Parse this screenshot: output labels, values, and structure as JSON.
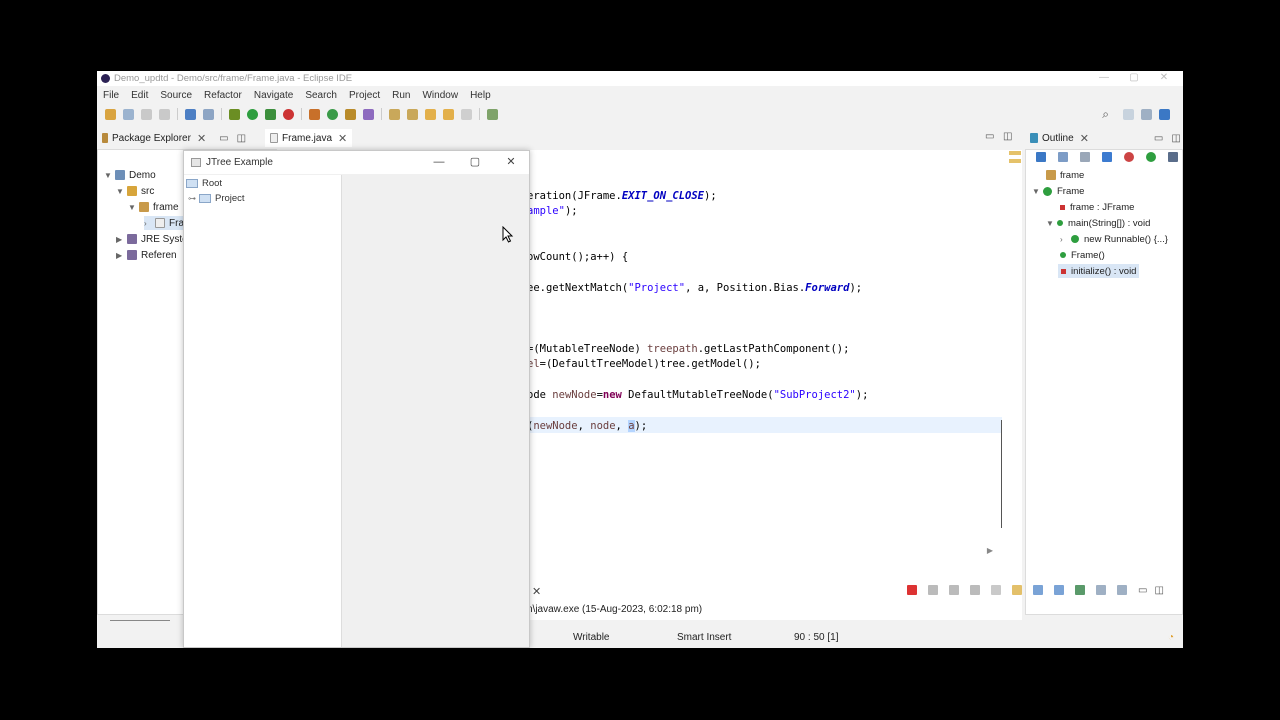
{
  "window": {
    "title": "Demo_updtd - Demo/src/frame/Frame.java - Eclipse IDE",
    "controls": [
      "—",
      "▢",
      "✕"
    ]
  },
  "menu": [
    "File",
    "Edit",
    "Source",
    "Refactor",
    "Navigate",
    "Search",
    "Project",
    "Run",
    "Window",
    "Help"
  ],
  "left_view": {
    "tab_label": "Package Explorer",
    "tree": [
      {
        "label": "Demo"
      },
      {
        "label": "src"
      },
      {
        "label": "frame"
      },
      {
        "label": "Fra"
      },
      {
        "label": "JRE Syste"
      },
      {
        "label": "Referen"
      }
    ]
  },
  "editor": {
    "tab_label": "Frame.java",
    "lines": [
      {
        "parts": [
          {
            "t": "eration(JFrame.",
            "c": ""
          },
          {
            "t": "EXIT_ON_CLOSE",
            "c": "fld"
          },
          {
            "t": ");",
            "c": ""
          }
        ]
      },
      {
        "parts": [
          {
            "t": "ample\"",
            "c": "str"
          },
          {
            "t": ");",
            "c": ""
          }
        ]
      },
      {
        "parts": [
          {
            "t": "owCount();a++) {",
            "c": ""
          }
        ]
      },
      {
        "parts": [
          {
            "t": "ee.getNextMatch(",
            "c": ""
          },
          {
            "t": "\"Project\"",
            "c": "str"
          },
          {
            "t": ", a, Position.Bias.",
            "c": ""
          },
          {
            "t": "Forward",
            "c": "fld"
          },
          {
            "t": ");",
            "c": ""
          }
        ]
      },
      {
        "parts": [
          {
            "t": "=(MutableTreeNode) ",
            "c": ""
          },
          {
            "t": "treepath",
            "c": "loc"
          },
          {
            "t": ".getLastPathComponent();",
            "c": ""
          }
        ]
      },
      {
        "parts": [
          {
            "t": "el",
            "c": "loc"
          },
          {
            "t": "=(DefaultTreeModel)tree.getModel();",
            "c": ""
          }
        ]
      },
      {
        "parts": [
          {
            "t": "ode ",
            "c": ""
          },
          {
            "t": "newNode",
            "c": "loc"
          },
          {
            "t": "=",
            "c": ""
          },
          {
            "t": "new",
            "c": "kw"
          },
          {
            "t": " DefaultMutableTreeNode(",
            "c": ""
          },
          {
            "t": "\"SubProject2\"",
            "c": "str"
          },
          {
            "t": ");",
            "c": ""
          }
        ]
      },
      {
        "parts": [
          {
            "t": "(",
            "c": ""
          },
          {
            "t": "newNode",
            "c": "loc"
          },
          {
            "t": ", ",
            "c": ""
          },
          {
            "t": "node",
            "c": "loc"
          },
          {
            "t": ", ",
            "c": ""
          },
          {
            "t": "a",
            "c": "loc"
          },
          {
            "t": ");",
            "c": ""
          }
        ]
      }
    ]
  },
  "outline": {
    "tab_label": "Outline",
    "items": [
      {
        "label": "frame"
      },
      {
        "label": "Frame"
      },
      {
        "label": "frame : JFrame"
      },
      {
        "label": "main(String[]) : void"
      },
      {
        "label": "new Runnable() {...}"
      },
      {
        "label": "Frame()"
      },
      {
        "label": "initialize() : void"
      }
    ]
  },
  "console": {
    "text": "n\\javaw.exe  (15-Aug-2023, 6:02:18 pm)"
  },
  "statusbar": {
    "writable": "Writable",
    "insert_mode": "Smart Insert",
    "position": "90 : 50 [1]"
  },
  "jframe": {
    "title": "JTree Example",
    "controls": [
      "—",
      "▢",
      "✕"
    ],
    "root": "Root",
    "child": "Project"
  }
}
